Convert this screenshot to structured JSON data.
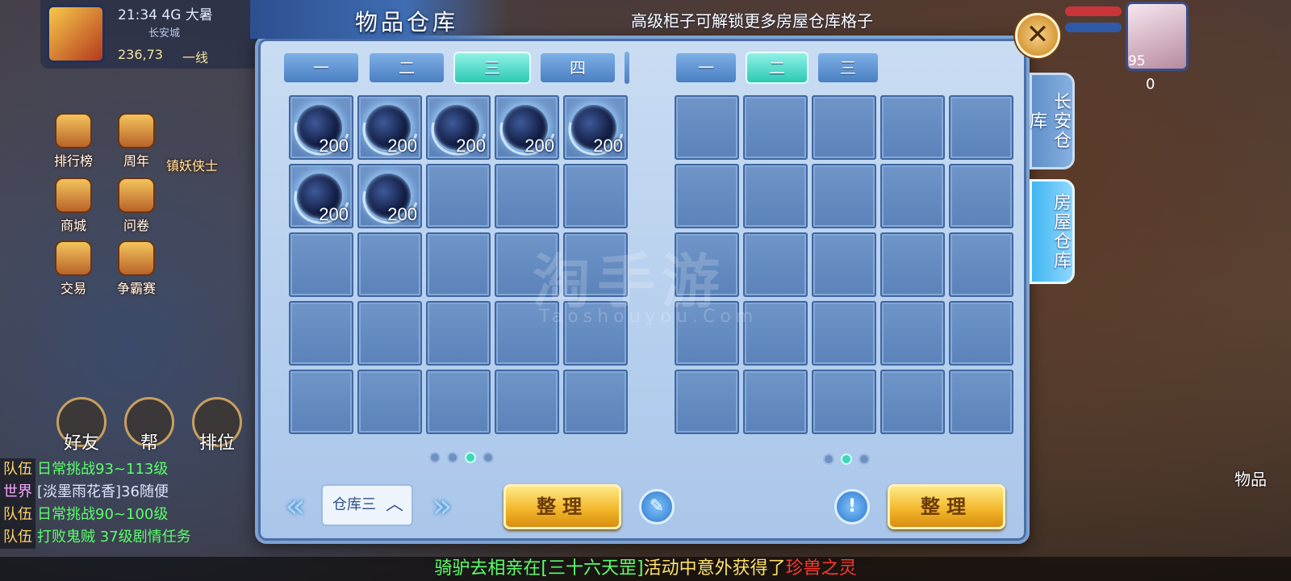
{
  "hud": {
    "time": "21:34",
    "net": "4G",
    "weather": "大暑",
    "city": "长安城",
    "coords": "236,73",
    "line": "一线",
    "level": "95",
    "counter": "0",
    "right_label": "物品"
  },
  "side_icons": [
    {
      "label": "排行榜"
    },
    {
      "label": "周年"
    },
    {
      "label": "镇妖侠士"
    },
    {
      "label": "商城"
    },
    {
      "label": "问卷"
    },
    {
      "label": "交易"
    },
    {
      "label": "争霸赛"
    }
  ],
  "bottom_round": [
    {
      "label": "好友"
    },
    {
      "label": "帮"
    },
    {
      "label": "排位"
    }
  ],
  "chat": [
    {
      "tag": "队伍",
      "text": "日常挑战93~113级"
    },
    {
      "tag": "世界",
      "text": "[淡墨雨花香]36随便"
    },
    {
      "tag": "队伍",
      "text": "日常挑战90~100级"
    },
    {
      "tag": "队伍",
      "text": "打败鬼贼 37级剧情任务"
    }
  ],
  "marquee": {
    "part1": "骑驴去相亲在",
    "part2": "[三十六天罡]",
    "part3": "活动中意外获得了",
    "part4": "珍兽之灵"
  },
  "dialog": {
    "title": "物品仓库",
    "hint": "高级柜子可解锁更多房屋仓库格子",
    "close_symbol": "✕",
    "left_tabs": [
      {
        "label": "一",
        "active": false
      },
      {
        "label": "二",
        "active": false
      },
      {
        "label": "三",
        "active": true
      },
      {
        "label": "四",
        "active": false
      }
    ],
    "right_tabs": [
      {
        "label": "一",
        "active": false
      },
      {
        "label": "二",
        "active": true
      },
      {
        "label": "三",
        "active": false
      }
    ],
    "left_items": [
      {
        "count": "200"
      },
      {
        "count": "200"
      },
      {
        "count": "200"
      },
      {
        "count": "200"
      },
      {
        "count": "200"
      },
      {
        "count": "200"
      },
      {
        "count": "200"
      }
    ],
    "left_slots_total": 25,
    "right_slots_total": 25,
    "left_page_dots": 4,
    "left_page_active": 3,
    "right_page_dots": 3,
    "right_page_active": 2,
    "select_value": "仓库三",
    "sort_left": "整理",
    "sort_right": "整理",
    "info_symbol": "!",
    "edit_symbol": "✎",
    "side_tabs": [
      {
        "label": "长安仓库",
        "active": false
      },
      {
        "label": "房屋仓库",
        "active": true
      }
    ],
    "arrow_prev": "«",
    "arrow_next": "»"
  },
  "watermark": {
    "main": "淘手游",
    "sub": "Taoshouyou.Com"
  },
  "colors": {
    "accent_tab": "#2cc9b4",
    "gold_button": "#f2b327",
    "panel": "#a9c6ea"
  }
}
